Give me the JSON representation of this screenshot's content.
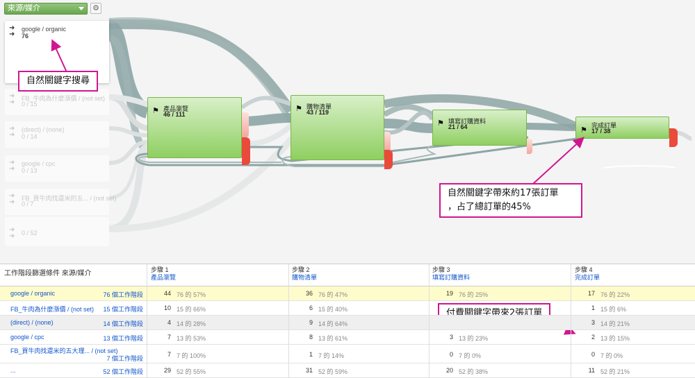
{
  "toolbar": {
    "dimension_label": "來源/媒介",
    "settings_icon": "gear-icon"
  },
  "sources": [
    {
      "name": "google / organic",
      "count": "76",
      "active": true
    },
    {
      "name": "FB_牛肉為什麼漲價 / (not set)",
      "count": "0 / 15",
      "active": false
    },
    {
      "name": "(direct) / (none)",
      "count": "0 / 14",
      "active": false
    },
    {
      "name": "google / cpc",
      "count": "0 / 13",
      "active": false
    },
    {
      "name": "FB_買牛肉找還米的五... / (not set)",
      "count": "0 / 7",
      "active": false
    },
    {
      "name": "",
      "count": "0 / 52",
      "active": false
    }
  ],
  "stages": [
    {
      "name": "產品瀏覽",
      "count": "46 / 111"
    },
    {
      "name": "購物清單",
      "count": "43 / 119"
    },
    {
      "name": "填寫訂購資料",
      "count": "21 / 64"
    },
    {
      "name": "完成訂單",
      "count": "17 / 38"
    }
  ],
  "notes": {
    "organic": "自然關鍵字搜尋",
    "orders_line1": "自然關鍵字帶來約17張訂單",
    "orders_line2": "，占了總訂單的45%",
    "paid": "付費關鍵字帶來2張訂單"
  },
  "colors": {
    "stage_green": "#8fcf61",
    "drop_red": "#ea4a3b",
    "flow_gray": "#8da5a5",
    "note_border": "#d0168f",
    "link_blue": "#1155cc"
  },
  "table": {
    "dimension_header": "工作階段篩選條件 來源/媒介",
    "steps": [
      {
        "step": "步驟 1",
        "name": "產品瀏覽"
      },
      {
        "step": "步驟 2",
        "name": "購物清單"
      },
      {
        "step": "步驟 3",
        "name": "填寫訂購資料"
      },
      {
        "step": "步驟 4",
        "name": "完成訂單"
      }
    ],
    "rows": [
      {
        "name": "google / organic",
        "sessions": "76 個工作階段",
        "cells": [
          [
            "44",
            "76 的 57%"
          ],
          [
            "36",
            "76 的 47%"
          ],
          [
            "19",
            "76 的 25%"
          ],
          [
            "17",
            "76 的 22%"
          ]
        ]
      },
      {
        "name": "FB_牛肉為什麼漲價 / (not set)",
        "sessions": "15 個工作階段",
        "cells": [
          [
            "10",
            "15 的 66%"
          ],
          [
            "6",
            "15 的 40%"
          ],
          [
            "",
            ""
          ],
          [
            "1",
            "15 的 6%"
          ]
        ]
      },
      {
        "name": "(direct) / (none)",
        "sessions": "14 個工作階段",
        "cells": [
          [
            "4",
            "14 的 28%"
          ],
          [
            "9",
            "14 的 64%"
          ],
          [
            "",
            ""
          ],
          [
            "3",
            "14 的 21%"
          ]
        ]
      },
      {
        "name": "google / cpc",
        "sessions": "13 個工作階段",
        "cells": [
          [
            "7",
            "13 的 53%"
          ],
          [
            "8",
            "13 的 61%"
          ],
          [
            "3",
            "13 的 23%"
          ],
          [
            "2",
            "13 的 15%"
          ]
        ]
      },
      {
        "name": "FB_買牛肉找還米的五大理... / (not set)",
        "sessions": "7 個工作階段",
        "cells": [
          [
            "7",
            "7 的 100%"
          ],
          [
            "1",
            "7 的 14%"
          ],
          [
            "0",
            "7 的 0%"
          ],
          [
            "0",
            "7 的 0%"
          ]
        ]
      },
      {
        "name": "...",
        "sessions": "52 個工作階段",
        "cells": [
          [
            "29",
            "52 的 55%"
          ],
          [
            "31",
            "52 的 59%"
          ],
          [
            "20",
            "52 的 38%"
          ],
          [
            "11",
            "52 的 21%"
          ]
        ]
      }
    ]
  }
}
